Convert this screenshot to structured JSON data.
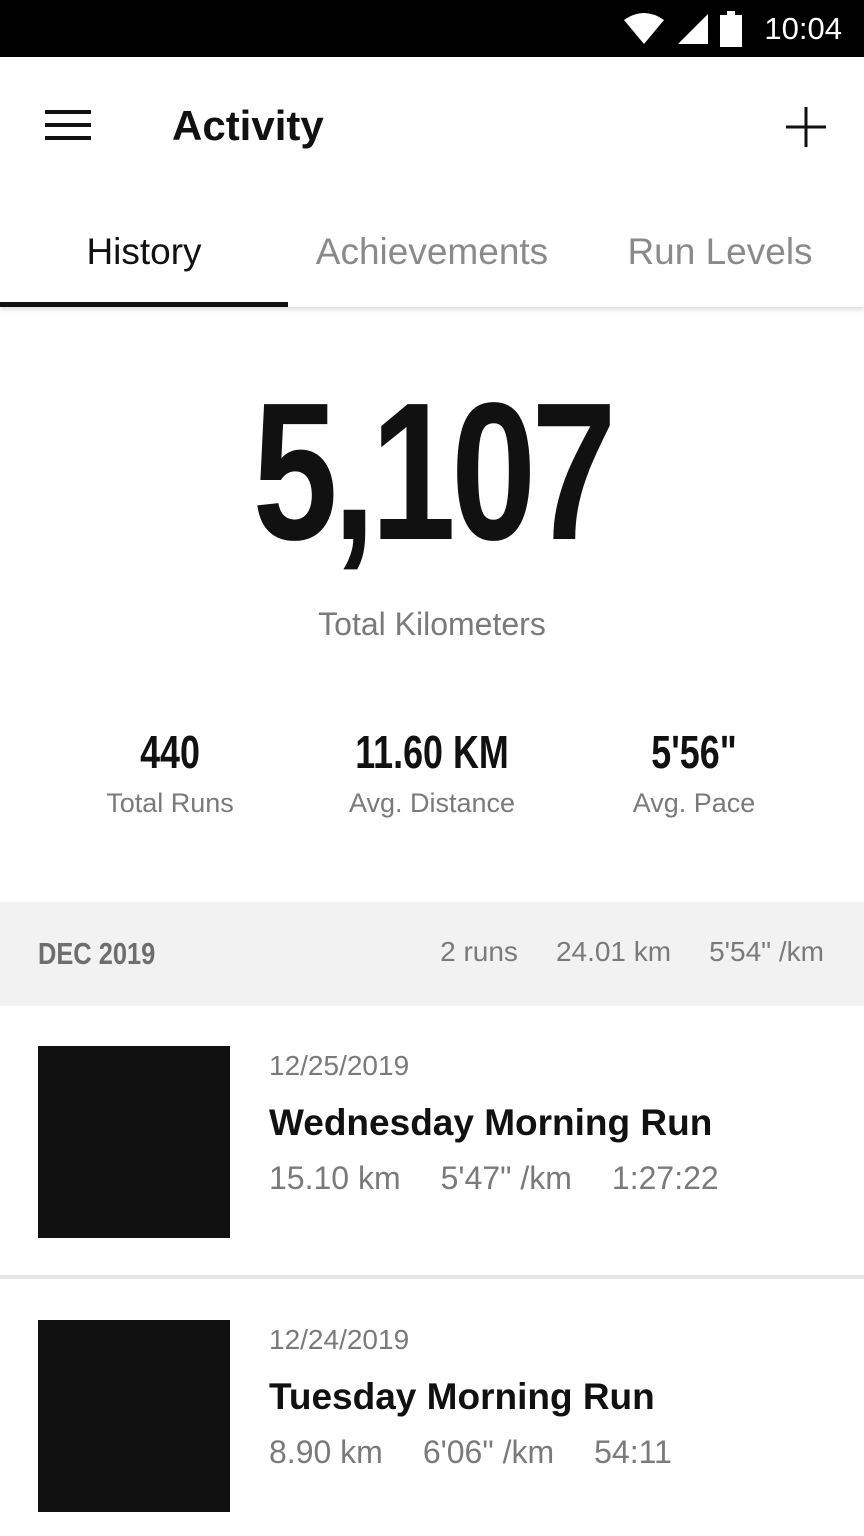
{
  "status_bar": {
    "time": "10:04",
    "icons": [
      "wifi-icon",
      "cell-signal-icon",
      "battery-icon"
    ]
  },
  "app_bar": {
    "title": "Activity",
    "menu_icon": "hamburger-menu-icon",
    "add_icon": "plus-icon"
  },
  "tabs": [
    {
      "label": "History",
      "active": true
    },
    {
      "label": "Achievements",
      "active": false
    },
    {
      "label": "Run Levels",
      "active": false
    }
  ],
  "summary": {
    "total_value": "5,107",
    "total_label": "Total Kilometers",
    "stats": [
      {
        "value": "440",
        "label": "Total Runs"
      },
      {
        "value": "11.60 KM",
        "label": "Avg. Distance"
      },
      {
        "value": "5'56\"",
        "label": "Avg. Pace"
      }
    ]
  },
  "month": {
    "label": "DEC 2019",
    "runs": "2 runs",
    "distance": "24.01 km",
    "pace": "5'54\" /km"
  },
  "runs": [
    {
      "date": "12/25/2019",
      "title": "Wednesday Morning Run",
      "distance": "15.10 km",
      "pace": "5'47\" /km",
      "duration": "1:27:22"
    },
    {
      "date": "12/24/2019",
      "title": "Tuesday Morning Run",
      "distance": "8.90 km",
      "pace": "6'06\" /km",
      "duration": "54:11"
    }
  ],
  "colors": {
    "status_bar": "#000000",
    "text_primary": "#111111",
    "text_secondary": "#7a7a7a",
    "month_header_bg": "#f2f2f2",
    "thumbnail": "#111111"
  }
}
